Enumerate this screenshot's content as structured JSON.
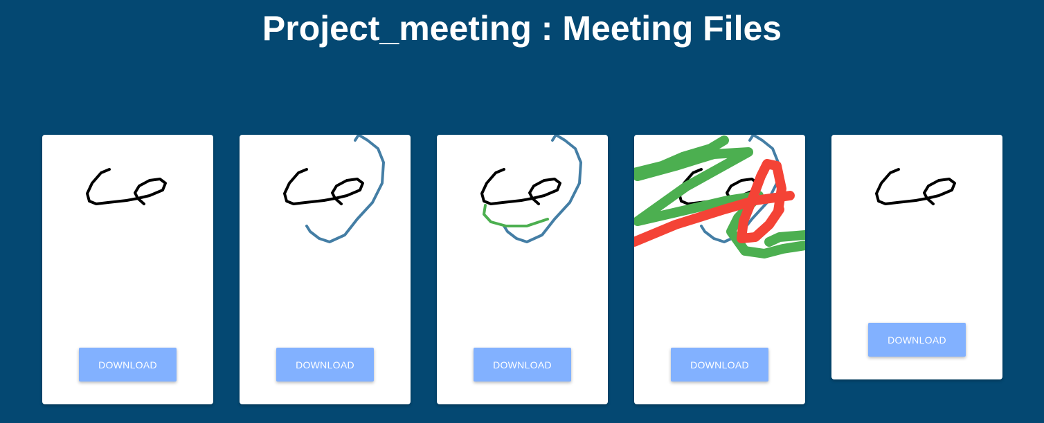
{
  "page": {
    "title": "Project_meeting : Meeting Files",
    "background_color": "#044872"
  },
  "colors": {
    "button": "#82b1ff",
    "ink_black": "#000000",
    "ink_blue": "#447ea5",
    "ink_green": "#4caf50",
    "ink_red": "#f44336"
  },
  "files": [
    {
      "download_label": "DOWNLOAD",
      "strokes": [
        "black"
      ]
    },
    {
      "download_label": "DOWNLOAD",
      "strokes": [
        "black",
        "blue"
      ]
    },
    {
      "download_label": "DOWNLOAD",
      "strokes": [
        "black",
        "blue",
        "green"
      ]
    },
    {
      "download_label": "DOWNLOAD",
      "strokes": [
        "black",
        "blue",
        "green",
        "red"
      ]
    },
    {
      "download_label": "DOWNLOAD",
      "strokes": [
        "black"
      ]
    }
  ]
}
